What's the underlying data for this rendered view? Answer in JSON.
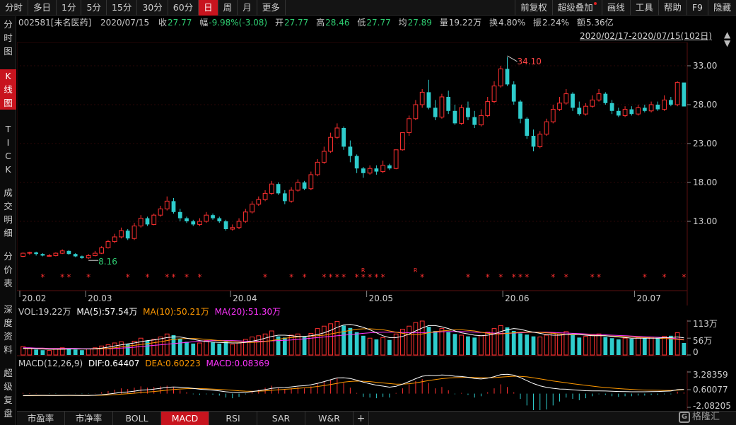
{
  "toolbar": {
    "left": [
      "分时",
      "多日",
      "1分",
      "5分",
      "15分",
      "30分",
      "60分",
      "日",
      "周",
      "月",
      "更多"
    ],
    "active_index": 7,
    "right": [
      "前复权",
      "超级叠加",
      "画线",
      "工具",
      "帮助",
      "F9",
      "隐藏"
    ]
  },
  "sidenav": [
    {
      "label": [
        "分",
        "时",
        "图"
      ],
      "top": 0,
      "active": false
    },
    {
      "label": [
        "K",
        "线",
        "图"
      ],
      "top": 1,
      "active": true
    },
    {
      "label": [
        "T",
        "I",
        "C",
        "K"
      ],
      "top": 2,
      "active": false
    },
    {
      "label": [
        "成",
        "交",
        "明",
        "细"
      ],
      "top": 3,
      "active": false
    },
    {
      "label": [
        "分",
        "价",
        "表"
      ],
      "top": 4,
      "active": false
    },
    {
      "label": [
        "深",
        "度",
        "资",
        "料"
      ],
      "top": 5,
      "active": false
    },
    {
      "label": [
        "超",
        "级",
        "复",
        "盘"
      ],
      "top": 6,
      "active": false
    }
  ],
  "quote": {
    "code": "002581[未名医药]",
    "date": "2020/07/15",
    "close_label": "收",
    "close": "27.77",
    "chg_label": "幅",
    "chg": "-9.98%(-3.08)",
    "open_label": "开",
    "open": "27.77",
    "high_label": "高",
    "high": "28.46",
    "low_label": "低",
    "low": "27.77",
    "avg_label": "均",
    "avg": "27.89",
    "vol_label": "量",
    "vol": "19.22万",
    "turnover_label": "换",
    "turnover": "4.80%",
    "amp_label": "振",
    "amp": "2.24%",
    "amount_label": "额",
    "amount": "5.36亿"
  },
  "range_text": "2020/02/17-2020/07/15(102日)",
  "main_axis": {
    "ticks": [
      "33.00",
      "28.00",
      "23.00",
      "18.00",
      "13.00"
    ]
  },
  "x_labels": [
    "20.02",
    "20.03",
    "20.04",
    "20.05",
    "20.06",
    "20.07"
  ],
  "annotations": {
    "high": "34.10",
    "low": "8.16"
  },
  "star_glyph": "*",
  "r_glyph": "R",
  "vol_panel": {
    "vol_text": "VOL:19.22万",
    "ma5_text": "MA(5):57.54万",
    "ma10_text": "MA(10):50.21万",
    "ma20_text": "MA(20):51.30万",
    "ticks": [
      "113万",
      "56万",
      "0"
    ]
  },
  "macd_panel": {
    "title": "MACD(12,26,9)",
    "dif_text": "DIF:0.64407",
    "dea_text": "DEA:0.60223",
    "macd_text": "MACD:0.08369",
    "ticks": [
      "3.28359",
      "0.60077",
      "-2.08205"
    ]
  },
  "bottom_tabs": [
    "市盈率",
    "市净率",
    "BOLL",
    "MACD",
    "RSI",
    "SAR",
    "W&R",
    "+"
  ],
  "bottom_active": 3,
  "logo_text": "格隆汇",
  "colors": {
    "up": "#ff3030",
    "down": "#2ecccc",
    "ma5": "#ffffff",
    "ma10": "#ff9900",
    "ma20": "#ff33ff"
  },
  "chart_data": {
    "type": "candlestick",
    "ylim": [
      6,
      36
    ],
    "candles": [
      [
        8.5,
        8.9,
        8.4,
        9.0
      ],
      [
        8.9,
        9.0,
        8.7,
        9.1
      ],
      [
        9.0,
        8.8,
        8.6,
        9.1
      ],
      [
        8.8,
        8.6,
        8.5,
        8.9
      ],
      [
        8.6,
        8.6,
        8.5,
        8.8
      ],
      [
        8.6,
        8.9,
        8.5,
        9.0
      ],
      [
        8.9,
        9.2,
        8.8,
        9.4
      ],
      [
        9.2,
        8.8,
        8.7,
        9.3
      ],
      [
        8.8,
        8.5,
        8.4,
        8.9
      ],
      [
        8.5,
        8.3,
        8.2,
        8.6
      ],
      [
        8.3,
        8.6,
        8.16,
        8.8
      ],
      [
        8.6,
        8.9,
        8.5,
        9.2
      ],
      [
        8.9,
        9.6,
        8.8,
        9.8
      ],
      [
        9.6,
        10.4,
        9.5,
        10.6
      ],
      [
        10.4,
        11.0,
        10.2,
        11.4
      ],
      [
        11.0,
        11.8,
        10.8,
        12.2
      ],
      [
        11.8,
        10.8,
        10.6,
        12.0
      ],
      [
        10.8,
        12.4,
        10.6,
        12.8
      ],
      [
        12.4,
        13.4,
        12.2,
        13.8
      ],
      [
        13.4,
        12.6,
        12.4,
        13.6
      ],
      [
        12.6,
        13.8,
        12.5,
        14.0
      ],
      [
        13.8,
        14.6,
        13.6,
        15.0
      ],
      [
        14.6,
        15.6,
        14.4,
        16.2
      ],
      [
        15.6,
        14.2,
        14.0,
        16.0
      ],
      [
        14.2,
        13.4,
        13.0,
        14.6
      ],
      [
        13.4,
        13.0,
        12.8,
        13.6
      ],
      [
        13.0,
        12.6,
        12.4,
        13.2
      ],
      [
        12.6,
        13.0,
        12.4,
        13.4
      ],
      [
        13.0,
        13.8,
        12.8,
        14.2
      ],
      [
        13.8,
        13.4,
        13.2,
        14.0
      ],
      [
        13.4,
        13.0,
        12.8,
        13.6
      ],
      [
        13.0,
        12.0,
        11.8,
        13.2
      ],
      [
        12.0,
        12.2,
        11.8,
        12.6
      ],
      [
        12.2,
        13.0,
        12.0,
        13.4
      ],
      [
        13.0,
        14.2,
        12.8,
        14.6
      ],
      [
        14.2,
        15.2,
        14.0,
        15.6
      ],
      [
        15.2,
        15.8,
        15.0,
        16.2
      ],
      [
        15.8,
        16.6,
        15.6,
        17.0
      ],
      [
        16.6,
        17.8,
        16.4,
        18.2
      ],
      [
        17.8,
        16.6,
        16.4,
        18.0
      ],
      [
        16.6,
        15.6,
        15.2,
        17.0
      ],
      [
        15.6,
        17.0,
        15.4,
        17.4
      ],
      [
        17.0,
        18.0,
        16.8,
        18.4
      ],
      [
        18.0,
        17.2,
        17.0,
        18.2
      ],
      [
        17.2,
        19.0,
        17.0,
        19.4
      ],
      [
        19.0,
        20.6,
        18.8,
        21.0
      ],
      [
        20.6,
        22.0,
        20.4,
        22.6
      ],
      [
        22.0,
        23.8,
        21.8,
        24.4
      ],
      [
        23.8,
        25.0,
        23.6,
        25.6
      ],
      [
        25.0,
        22.6,
        22.2,
        25.2
      ],
      [
        22.6,
        21.4,
        20.6,
        23.4
      ],
      [
        21.4,
        19.8,
        19.2,
        21.6
      ],
      [
        19.8,
        19.2,
        18.6,
        20.0
      ],
      [
        19.2,
        19.8,
        19.0,
        20.2
      ],
      [
        19.8,
        19.4,
        19.0,
        20.2
      ],
      [
        19.4,
        20.2,
        19.2,
        20.8
      ],
      [
        20.2,
        19.8,
        19.6,
        20.4
      ],
      [
        19.8,
        22.2,
        19.7,
        22.2
      ],
      [
        22.2,
        24.4,
        22.1,
        24.4
      ],
      [
        24.4,
        26.2,
        24.0,
        26.6
      ],
      [
        26.2,
        28.0,
        26.0,
        28.6
      ],
      [
        28.0,
        29.6,
        27.6,
        30.0
      ],
      [
        29.6,
        27.6,
        27.4,
        31.2
      ],
      [
        27.6,
        26.4,
        26.0,
        28.6
      ],
      [
        26.4,
        29.0,
        26.2,
        29.4
      ],
      [
        29.0,
        27.2,
        26.8,
        29.8
      ],
      [
        27.2,
        25.6,
        25.4,
        28.0
      ],
      [
        25.6,
        27.6,
        25.4,
        28.0
      ],
      [
        27.6,
        26.4,
        26.0,
        28.4
      ],
      [
        26.4,
        25.4,
        25.0,
        27.2
      ],
      [
        25.4,
        26.6,
        25.2,
        27.4
      ],
      [
        26.6,
        28.4,
        26.4,
        29.0
      ],
      [
        28.4,
        30.4,
        28.2,
        31.0
      ],
      [
        30.4,
        32.6,
        30.2,
        33.0
      ],
      [
        32.6,
        30.6,
        30.4,
        34.1
      ],
      [
        30.6,
        28.4,
        28.0,
        31.0
      ],
      [
        28.4,
        26.2,
        25.6,
        28.6
      ],
      [
        26.2,
        24.0,
        23.6,
        26.4
      ],
      [
        24.0,
        22.6,
        22.0,
        24.8
      ],
      [
        22.6,
        24.2,
        22.4,
        24.6
      ],
      [
        24.2,
        25.8,
        24.0,
        26.2
      ],
      [
        25.8,
        27.4,
        25.6,
        28.0
      ],
      [
        27.4,
        28.2,
        27.2,
        29.0
      ],
      [
        28.2,
        29.4,
        28.0,
        30.0
      ],
      [
        29.4,
        27.6,
        27.2,
        29.6
      ],
      [
        27.6,
        26.8,
        26.6,
        28.4
      ],
      [
        26.8,
        27.8,
        26.6,
        28.2
      ],
      [
        27.8,
        28.6,
        27.6,
        29.2
      ],
      [
        28.6,
        29.4,
        28.4,
        30.0
      ],
      [
        29.4,
        28.2,
        28.0,
        29.6
      ],
      [
        28.2,
        27.2,
        26.8,
        28.6
      ],
      [
        27.2,
        26.6,
        26.4,
        27.6
      ],
      [
        26.6,
        27.4,
        26.4,
        27.8
      ],
      [
        27.4,
        26.8,
        26.6,
        27.8
      ],
      [
        26.8,
        27.6,
        26.6,
        28.0
      ],
      [
        27.6,
        27.2,
        27.0,
        28.0
      ],
      [
        27.2,
        28.0,
        27.0,
        28.4
      ],
      [
        28.0,
        27.4,
        27.2,
        28.4
      ],
      [
        27.4,
        28.6,
        27.2,
        29.2
      ],
      [
        28.6,
        28.0,
        27.8,
        29.0
      ],
      [
        28.0,
        30.85,
        27.8,
        31.0
      ],
      [
        30.85,
        27.77,
        27.77,
        28.46
      ]
    ],
    "stars": [
      3,
      6,
      7,
      10,
      16,
      19,
      22,
      23,
      25,
      27,
      37,
      41,
      43,
      46,
      47,
      48,
      49,
      51,
      52,
      53,
      54,
      55,
      61,
      68,
      71,
      73,
      75,
      76,
      77,
      81,
      83,
      87,
      88,
      95,
      98,
      101,
      102
    ],
    "r_marks": [
      52,
      60
    ],
    "volumes": [
      28,
      22,
      18,
      16,
      15,
      20,
      24,
      22,
      18,
      16,
      20,
      24,
      30,
      34,
      40,
      44,
      36,
      46,
      56,
      48,
      52,
      60,
      70,
      66,
      54,
      44,
      38,
      40,
      48,
      42,
      38,
      44,
      36,
      40,
      52,
      60,
      64,
      70,
      80,
      62,
      58,
      66,
      70,
      60,
      72,
      88,
      96,
      104,
      112,
      98,
      90,
      76,
      64,
      56,
      52,
      58,
      50,
      70,
      86,
      96,
      108,
      113,
      94,
      80,
      88,
      76,
      70,
      66,
      62,
      58,
      64,
      76,
      88,
      98,
      92,
      80,
      72,
      68,
      62,
      60,
      66,
      74,
      70,
      78,
      66,
      58,
      62,
      66,
      70,
      60,
      56,
      52,
      56,
      54,
      58,
      56,
      60,
      58,
      62,
      64,
      74,
      40
    ],
    "ma5": [
      22,
      22,
      21,
      20,
      19,
      19,
      19,
      20,
      20,
      20,
      20,
      21,
      23,
      26,
      30,
      34,
      37,
      40,
      44,
      48,
      50,
      54,
      58,
      60,
      60,
      56,
      52,
      48,
      45,
      43,
      42,
      41,
      40,
      40,
      42,
      46,
      50,
      56,
      62,
      66,
      66,
      64,
      62,
      62,
      64,
      68,
      74,
      82,
      92,
      100,
      102,
      98,
      92,
      84,
      74,
      64,
      58,
      58,
      62,
      70,
      80,
      90,
      98,
      98,
      94,
      88,
      80,
      74,
      70,
      66,
      64,
      66,
      70,
      78,
      84,
      88,
      86,
      80,
      76,
      72,
      68,
      66,
      66,
      68,
      70,
      68,
      66,
      64,
      64,
      64,
      62,
      60,
      58,
      56,
      56,
      56,
      56,
      56,
      58,
      58,
      60,
      57
    ],
    "ma10": [
      22,
      22,
      21,
      21,
      20,
      20,
      20,
      20,
      20,
      20,
      20,
      20,
      21,
      22,
      24,
      27,
      30,
      32,
      35,
      38,
      41,
      44,
      48,
      52,
      54,
      55,
      55,
      54,
      52,
      50,
      48,
      46,
      44,
      43,
      42,
      42,
      43,
      45,
      48,
      52,
      56,
      58,
      60,
      62,
      63,
      64,
      66,
      70,
      74,
      78,
      82,
      86,
      87,
      87,
      86,
      84,
      80,
      76,
      72,
      68,
      68,
      70,
      74,
      78,
      80,
      82,
      84,
      84,
      82,
      80,
      76,
      72,
      70,
      70,
      72,
      74,
      76,
      76,
      76,
      75,
      74,
      72,
      70,
      68,
      68,
      68,
      67,
      66,
      65,
      64,
      63,
      62,
      61,
      60,
      59,
      58,
      57,
      56,
      55,
      54,
      52,
      50
    ],
    "ma20": [
      24,
      24,
      23,
      23,
      22,
      22,
      22,
      22,
      22,
      21,
      21,
      21,
      21,
      21,
      22,
      23,
      24,
      26,
      28,
      30,
      32,
      34,
      36,
      38,
      40,
      42,
      44,
      46,
      47,
      48,
      48,
      48,
      48,
      47,
      46,
      46,
      46,
      46,
      47,
      48,
      49,
      50,
      52,
      54,
      56,
      58,
      60,
      62,
      64,
      66,
      68,
      70,
      72,
      74,
      75,
      76,
      76,
      76,
      75,
      74,
      74,
      74,
      75,
      76,
      77,
      78,
      78,
      78,
      77,
      76,
      75,
      74,
      73,
      72,
      72,
      73,
      74,
      75,
      76,
      76,
      76,
      75,
      74,
      73,
      72,
      71,
      70,
      69,
      68,
      67,
      66,
      65,
      64,
      63,
      62,
      61,
      60,
      59,
      58,
      56,
      54,
      51
    ],
    "macd_hist": [
      0.05,
      0.04,
      0.02,
      0.0,
      -0.02,
      -0.02,
      0.0,
      0.01,
      -0.01,
      -0.03,
      -0.02,
      0.02,
      0.1,
      0.2,
      0.3,
      0.4,
      0.35,
      0.45,
      0.55,
      0.45,
      0.5,
      0.55,
      0.6,
      0.45,
      0.25,
      0.1,
      -0.05,
      -0.1,
      -0.05,
      -0.08,
      -0.15,
      -0.3,
      -0.35,
      -0.25,
      -0.05,
      0.15,
      0.3,
      0.45,
      0.6,
      0.45,
      0.3,
      0.4,
      0.5,
      0.4,
      0.55,
      0.75,
      0.9,
      1.05,
      1.15,
      0.8,
      0.45,
      0.05,
      -0.25,
      -0.3,
      -0.35,
      -0.25,
      -0.3,
      0.05,
      0.4,
      0.7,
      0.95,
      1.1,
      0.8,
      0.4,
      0.5,
      0.25,
      -0.05,
      0.05,
      -0.1,
      -0.3,
      -0.2,
      0.1,
      0.4,
      0.7,
      0.5,
      0.1,
      -0.4,
      -0.9,
      -1.3,
      -1.4,
      -1.2,
      -0.9,
      -0.6,
      -0.3,
      -0.4,
      -0.5,
      -0.35,
      -0.2,
      -0.05,
      -0.1,
      -0.2,
      -0.25,
      -0.2,
      -0.2,
      -0.15,
      -0.15,
      -0.1,
      -0.1,
      -0.05,
      -0.05,
      0.15,
      0.08
    ],
    "dif": [
      -0.3,
      -0.28,
      -0.27,
      -0.27,
      -0.28,
      -0.28,
      -0.27,
      -0.26,
      -0.27,
      -0.28,
      -0.28,
      -0.25,
      -0.18,
      -0.08,
      0.05,
      0.18,
      0.26,
      0.38,
      0.52,
      0.58,
      0.68,
      0.8,
      0.94,
      1.0,
      0.98,
      0.9,
      0.78,
      0.66,
      0.6,
      0.52,
      0.42,
      0.28,
      0.18,
      0.14,
      0.18,
      0.3,
      0.44,
      0.6,
      0.8,
      0.9,
      0.92,
      1.02,
      1.14,
      1.2,
      1.34,
      1.56,
      1.82,
      2.1,
      2.38,
      2.4,
      2.3,
      2.04,
      1.74,
      1.5,
      1.28,
      1.14,
      0.98,
      1.12,
      1.44,
      1.84,
      2.26,
      2.64,
      2.76,
      2.72,
      2.82,
      2.78,
      2.64,
      2.6,
      2.48,
      2.3,
      2.22,
      2.34,
      2.58,
      2.88,
      2.94,
      2.8,
      2.44,
      1.96,
      1.52,
      1.18,
      0.96,
      0.8,
      0.7,
      0.66,
      0.58,
      0.5,
      0.44,
      0.42,
      0.42,
      0.4,
      0.36,
      0.32,
      0.3,
      0.28,
      0.28,
      0.28,
      0.3,
      0.32,
      0.36,
      0.4,
      0.6,
      0.64
    ],
    "dea": [
      -0.32,
      -0.31,
      -0.3,
      -0.29,
      -0.29,
      -0.29,
      -0.28,
      -0.28,
      -0.28,
      -0.28,
      -0.28,
      -0.27,
      -0.25,
      -0.22,
      -0.16,
      -0.09,
      -0.02,
      0.06,
      0.15,
      0.24,
      0.32,
      0.42,
      0.52,
      0.62,
      0.7,
      0.75,
      0.77,
      0.76,
      0.73,
      0.69,
      0.64,
      0.57,
      0.5,
      0.43,
      0.38,
      0.36,
      0.38,
      0.42,
      0.5,
      0.58,
      0.65,
      0.72,
      0.8,
      0.88,
      0.97,
      1.08,
      1.22,
      1.38,
      1.56,
      1.74,
      1.85,
      1.9,
      1.88,
      1.82,
      1.72,
      1.62,
      1.52,
      1.44,
      1.44,
      1.5,
      1.62,
      1.8,
      1.98,
      2.12,
      2.26,
      2.36,
      2.42,
      2.46,
      2.48,
      2.46,
      2.42,
      2.4,
      2.42,
      2.5,
      2.58,
      2.64,
      2.62,
      2.54,
      2.4,
      2.24,
      2.08,
      1.92,
      1.78,
      1.64,
      1.5,
      1.38,
      1.26,
      1.14,
      1.02,
      0.92,
      0.84,
      0.76,
      0.7,
      0.64,
      0.58,
      0.54,
      0.52,
      0.5,
      0.48,
      0.48,
      0.52,
      0.6
    ]
  }
}
